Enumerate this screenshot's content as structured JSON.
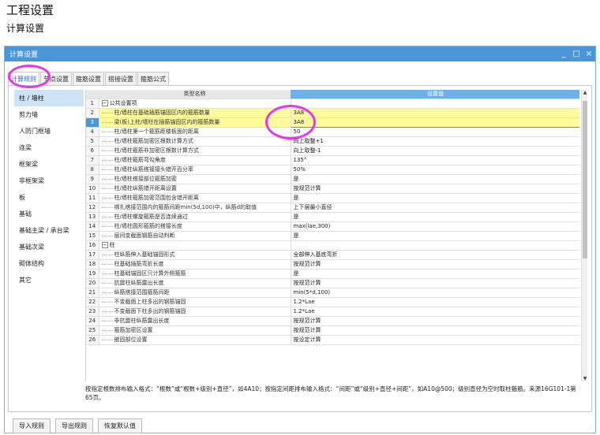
{
  "page": {
    "title": "工程设置",
    "subtitle": "计算设置"
  },
  "window": {
    "title": "计算设置",
    "min_label": "_",
    "max_label": "□",
    "close_label": "×"
  },
  "tabs": [
    {
      "label": "计算规则",
      "active": true
    },
    {
      "label": "节点设置"
    },
    {
      "label": "箍筋设置"
    },
    {
      "label": "搭接设置"
    },
    {
      "label": "箍筋公式"
    }
  ],
  "sidebar": {
    "items": [
      {
        "label": "柱 / 墙柱",
        "active": true
      },
      {
        "label": "剪力墙"
      },
      {
        "label": "人防门框墙"
      },
      {
        "label": "连梁"
      },
      {
        "label": "框架梁"
      },
      {
        "label": "非框架梁"
      },
      {
        "label": "板"
      },
      {
        "label": "基础"
      },
      {
        "label": "基础主梁 / 承台梁"
      },
      {
        "label": "基础次梁"
      },
      {
        "label": "砌体结构"
      },
      {
        "label": "其它"
      }
    ]
  },
  "table": {
    "headers": {
      "name": "类型名称",
      "value": "设置值"
    },
    "rows": [
      {
        "num": "1",
        "name": "公共设置项",
        "value": "",
        "group": true
      },
      {
        "num": "2",
        "name": "柱/墙柱在基础插筋锚固区内的箍筋数量",
        "value": "3A8",
        "yellow": true
      },
      {
        "num": "3",
        "name": "梁(板)上柱/墙柱在插筋锚固区内的箍筋数量",
        "value": "3A8",
        "selected": true
      },
      {
        "num": "4",
        "name": "柱/墙柱第一个箍筋距楼板面的距离",
        "value": "50"
      },
      {
        "num": "5",
        "name": "柱/墙柱箍筋加密区根数计算方式",
        "value": "向上取整+1"
      },
      {
        "num": "6",
        "name": "柱/墙柱箍筋非加密区根数计算方式",
        "value": "向上取整-1"
      },
      {
        "num": "7",
        "name": "柱/墙柱箍筋弯勾角度",
        "value": "135°"
      },
      {
        "num": "8",
        "name": "柱/墙柱纵筋搭接接头错开百分率",
        "value": "50%"
      },
      {
        "num": "9",
        "name": "柱/墙柱搭接部位箍筋加密",
        "value": "是"
      },
      {
        "num": "10",
        "name": "柱/墙柱纵筋错开距离设置",
        "value": "按规范计算"
      },
      {
        "num": "11",
        "name": "柱/墙柱箍筋加密范围包含错开距离",
        "value": "是"
      },
      {
        "num": "12",
        "name": "绑扎搭接范围内的箍筋间距min(5d,100)中，纵筋d的取值",
        "value": "上下层最小直径"
      },
      {
        "num": "13",
        "name": "柱/墙柱螺旋箍筋是否连续通过",
        "value": "是"
      },
      {
        "num": "14",
        "name": "柱/墙柱圆形箍筋的搭接长度",
        "value": "max(lae,300)"
      },
      {
        "num": "15",
        "name": "层间变截面钢筋自动判断",
        "value": "是"
      },
      {
        "num": "16",
        "name": "柱",
        "value": "",
        "group": true
      },
      {
        "num": "17",
        "name": "柱纵筋伸入基础锚固形式",
        "value": "全部伸入基底弯折"
      },
      {
        "num": "18",
        "name": "柱基础插筋弯折长度",
        "value": "按规范计算"
      },
      {
        "num": "19",
        "name": "柱基础锚固区只计算外侧箍筋",
        "value": "是"
      },
      {
        "num": "20",
        "name": "抗震柱纵筋露出长度",
        "value": "按规范计算"
      },
      {
        "num": "21",
        "name": "纵筋搭接范围箍筋间距",
        "value": "min(5*d,100)"
      },
      {
        "num": "22",
        "name": "不变截面上柱多出的钢筋锚固",
        "value": "1.2*Lae"
      },
      {
        "num": "23",
        "name": "不变截面下柱多出的钢筋锚固",
        "value": "1.2*Lae"
      },
      {
        "num": "24",
        "name": "非抗震柱纵筋露出长度",
        "value": "按规范计算"
      },
      {
        "num": "25",
        "name": "箍筋加密区设置",
        "value": "按规范计算"
      },
      {
        "num": "26",
        "name": "嵌固部位设置",
        "value": "按设定计算"
      }
    ]
  },
  "hint": "按指定根数排布输入格式：“根数”或“根数+级别+直径”，如4A10；按指定间距排布输入格式：“间距”或“级别+直径+间距”，如A10@500；级别直径为空时取柱箍筋。来源16G101-1第65页。",
  "buttons": {
    "import": "导入规则",
    "export": "导出规则",
    "restore": "恢复默认值"
  },
  "accent_color": "#4a96d9",
  "highlight_color": "#e837e8",
  "row_highlight_color": "#fffa9c"
}
